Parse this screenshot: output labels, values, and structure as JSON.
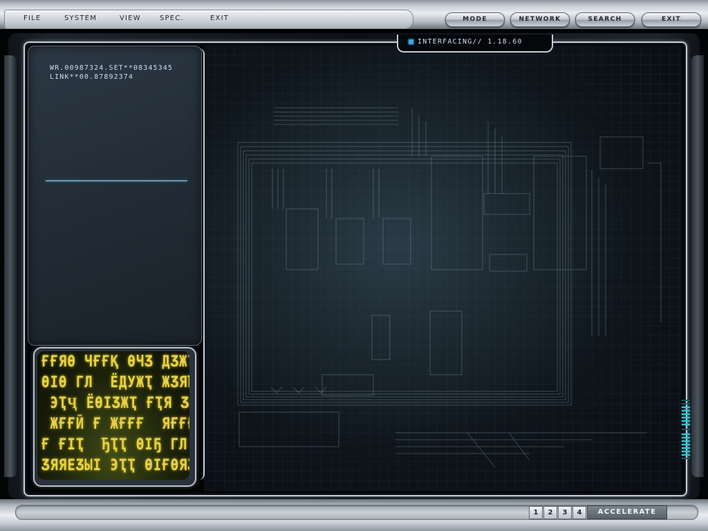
{
  "menu": {
    "items": [
      "FILE",
      "SYSTEM",
      "VIEW",
      "SPEC.",
      "EXIT"
    ]
  },
  "top_buttons": {
    "items": [
      "MODE",
      "NETWORK",
      "SEARCH",
      "EXIT"
    ]
  },
  "status": {
    "text": "INTERFACING// 1.18.60",
    "marker_color": "#3aa3e6"
  },
  "left_panel": {
    "readout_lines": [
      "WR.00987324.SET**08345345",
      "LINK**00.87892374"
    ],
    "divider_color": "#8fd4f0"
  },
  "bottom_bar": {
    "pages": [
      "1",
      "2",
      "3",
      "4"
    ],
    "accelerate_label": "ACCELERATE"
  },
  "colors": {
    "accent_cyan": "#2ec4d6",
    "glyph_yellow": "#e6d247",
    "chrome_light": "#e9edf0"
  },
  "icons": {
    "status_marker": "square-marker-icon",
    "glyph_display": "alien-glyph-screen"
  }
}
